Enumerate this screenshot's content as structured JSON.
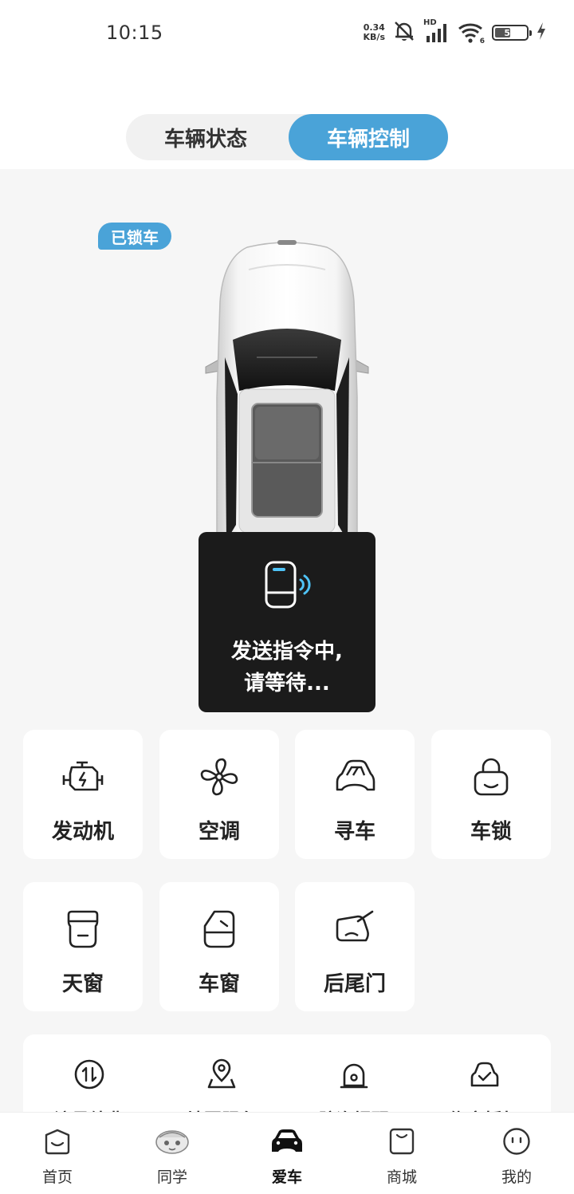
{
  "status_bar": {
    "time": "10:15",
    "net_speed_value": "0.34",
    "net_speed_unit": "KB/s",
    "network_type": "HD",
    "wifi_badge": "6",
    "battery_level": "55",
    "battery_fraction": 0.55,
    "icons": [
      "mute-icon",
      "signal-icon",
      "wifi-icon",
      "battery-icon",
      "charging-icon"
    ]
  },
  "tabs": [
    {
      "label": "车辆状态",
      "active": false
    },
    {
      "label": "车辆控制",
      "active": true
    }
  ],
  "vehicle": {
    "lock_status": "已锁车"
  },
  "toast": {
    "message": "发送指令中,\n请等待..."
  },
  "controls": [
    {
      "label": "发动机",
      "icon": "engine-icon"
    },
    {
      "label": "空调",
      "icon": "fan-icon"
    },
    {
      "label": "寻车",
      "icon": "find-car-icon"
    },
    {
      "label": "车锁",
      "icon": "lock-icon"
    },
    {
      "label": "天窗",
      "icon": "sunroof-icon"
    },
    {
      "label": "车窗",
      "icon": "window-icon"
    },
    {
      "label": "后尾门",
      "icon": "tailgate-icon"
    }
  ],
  "services": [
    {
      "label": "流量续费",
      "icon": "data-transfer-icon"
    },
    {
      "label": "地图服务",
      "icon": "map-pin-icon"
    },
    {
      "label": "防盗提醒",
      "icon": "alarm-icon"
    },
    {
      "label": "绑定授权",
      "icon": "car-authorize-icon"
    }
  ],
  "bottom_nav": [
    {
      "label": "首页",
      "icon": "home-icon",
      "active": false
    },
    {
      "label": "同学",
      "icon": "classmates-icon",
      "active": false
    },
    {
      "label": "爱车",
      "icon": "car-icon",
      "active": true
    },
    {
      "label": "商城",
      "icon": "shop-icon",
      "active": false
    },
    {
      "label": "我的",
      "icon": "profile-icon",
      "active": false
    }
  ],
  "colors": {
    "accent": "#4aa3d8",
    "background": "#f6f6f6",
    "card": "#ffffff",
    "toast": "#1b1b1b"
  }
}
